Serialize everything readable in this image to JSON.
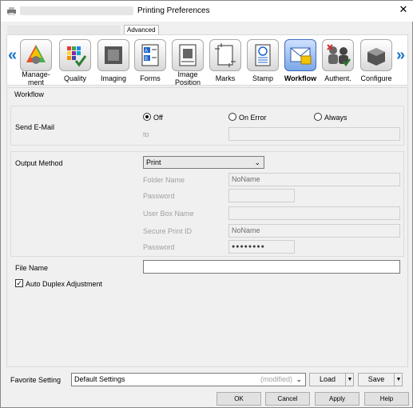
{
  "window": {
    "title": "Printing Preferences"
  },
  "tabs": [
    {
      "label": "Advanced"
    }
  ],
  "categories": [
    {
      "label": "Manage-\nment",
      "icon": "management-icon"
    },
    {
      "label": "Quality",
      "icon": "quality-icon"
    },
    {
      "label": "Imaging",
      "icon": "imaging-icon"
    },
    {
      "label": "Forms",
      "icon": "forms-icon"
    },
    {
      "label": "Image\nPosition",
      "icon": "image-position-icon"
    },
    {
      "label": "Marks",
      "icon": "marks-icon"
    },
    {
      "label": "Stamp",
      "icon": "stamp-icon"
    },
    {
      "label": "Workflow",
      "icon": "workflow-icon",
      "selected": true
    },
    {
      "label": "Authent.",
      "icon": "authentication-icon"
    },
    {
      "label": "Configure",
      "icon": "configure-icon"
    }
  ],
  "workflow": {
    "section_title": "Workflow",
    "send_email": {
      "label": "Send E-Mail",
      "options": [
        "Off",
        "On Error",
        "Always"
      ],
      "selected": "Off",
      "to_label": "to",
      "to_value": ""
    },
    "output_method": {
      "label": "Output Method",
      "value": "Print",
      "folder_name_label": "Folder Name",
      "folder_name_value": "NoName",
      "password_label": "Password",
      "password_value": "",
      "user_box_name_label": "User Box Name",
      "user_box_name_value": "",
      "secure_print_id_label": "Secure Print ID",
      "secure_print_id_value": "NoName",
      "secure_password_label": "Password",
      "secure_password_value": "●●●●●●●●"
    },
    "file_name": {
      "label": "File Name",
      "value": ""
    },
    "auto_duplex": {
      "label": "Auto Duplex Adjustment",
      "checked": true
    }
  },
  "favorite": {
    "label": "Favorite Setting",
    "value": "Default Settings",
    "modified": "(modified)",
    "load_label": "Load",
    "save_label": "Save"
  },
  "buttons": {
    "ok": "OK",
    "cancel": "Cancel",
    "apply": "Apply",
    "help": "Help"
  },
  "colors": {
    "accent": "#1a73c8",
    "selected_tab": "#7aa6e6"
  }
}
